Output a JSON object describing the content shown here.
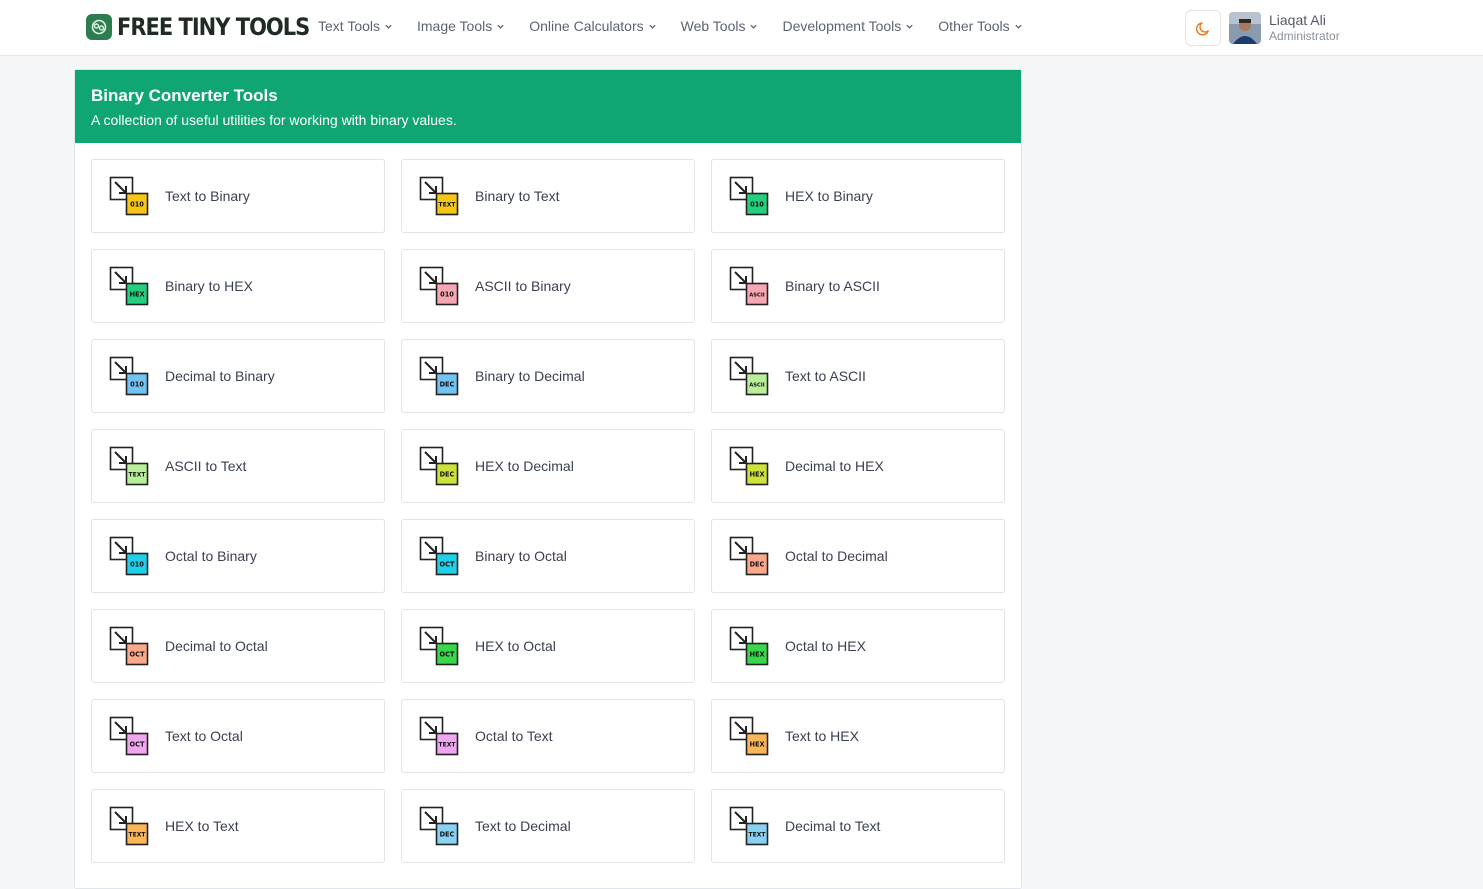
{
  "header": {
    "logo_text": "FREE TINY TOOLS",
    "nav": [
      {
        "label": "Text Tools"
      },
      {
        "label": "Image Tools"
      },
      {
        "label": "Online Calculators"
      },
      {
        "label": "Web Tools"
      },
      {
        "label": "Development Tools"
      },
      {
        "label": "Other Tools"
      }
    ],
    "user": {
      "name": "Liaqat Ali",
      "role": "Administrator"
    },
    "theme_icon": "moon-icon"
  },
  "panel": {
    "title": "Binary Converter Tools",
    "subtitle": "A collection of useful utilities for working with binary values."
  },
  "tools": [
    {
      "label": "Text to Binary",
      "badge": "010",
      "color": "#f5c518"
    },
    {
      "label": "Binary to Text",
      "badge": "TEXT",
      "color": "#f5c518"
    },
    {
      "label": "HEX to Binary",
      "badge": "010",
      "color": "#22d07f"
    },
    {
      "label": "Binary to HEX",
      "badge": "HEX",
      "color": "#22d07f"
    },
    {
      "label": "ASCII to Binary",
      "badge": "010",
      "color": "#f7a6b3"
    },
    {
      "label": "Binary to ASCII",
      "badge": "ASCII",
      "color": "#f7a6b3"
    },
    {
      "label": "Decimal to Binary",
      "badge": "010",
      "color": "#72c2f2"
    },
    {
      "label": "Binary to Decimal",
      "badge": "DEC",
      "color": "#72c2f2"
    },
    {
      "label": "Text to ASCII",
      "badge": "ASCII",
      "color": "#b9ef9a"
    },
    {
      "label": "ASCII to Text",
      "badge": "TEXT",
      "color": "#b9ef9a"
    },
    {
      "label": "HEX to Decimal",
      "badge": "DEC",
      "color": "#cde33b"
    },
    {
      "label": "Decimal to HEX",
      "badge": "HEX",
      "color": "#cde33b"
    },
    {
      "label": "Octal to Binary",
      "badge": "010",
      "color": "#1fd0e8"
    },
    {
      "label": "Binary to Octal",
      "badge": "OCT",
      "color": "#1fd0e8"
    },
    {
      "label": "Octal to Decimal",
      "badge": "DEC",
      "color": "#fba98a"
    },
    {
      "label": "Decimal to Octal",
      "badge": "OCT",
      "color": "#fba98a"
    },
    {
      "label": "HEX to Octal",
      "badge": "OCT",
      "color": "#37d84a"
    },
    {
      "label": "Octal to HEX",
      "badge": "HEX",
      "color": "#37d84a"
    },
    {
      "label": "Text to Octal",
      "badge": "OCT",
      "color": "#f0a6f0"
    },
    {
      "label": "Octal to Text",
      "badge": "TEXT",
      "color": "#f0a6f0"
    },
    {
      "label": "Text to HEX",
      "badge": "HEX",
      "color": "#fcb557"
    },
    {
      "label": "HEX to Text",
      "badge": "TEXT",
      "color": "#fcb557"
    },
    {
      "label": "Text to Decimal",
      "badge": "DEC",
      "color": "#88d1f2"
    },
    {
      "label": "Decimal to Text",
      "badge": "TEXT",
      "color": "#88d1f2"
    }
  ]
}
